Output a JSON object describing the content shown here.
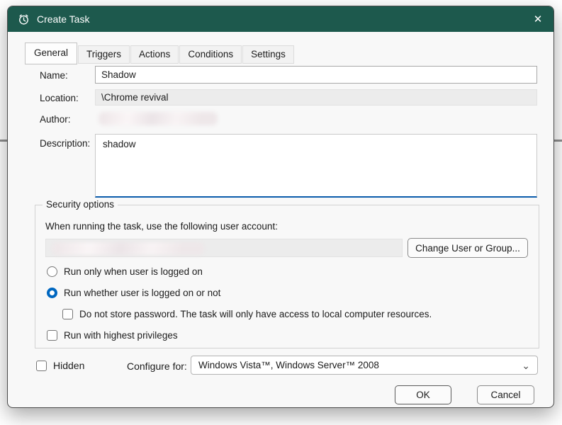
{
  "window": {
    "title": "Create Task"
  },
  "icons": {
    "close": "✕",
    "chevron_down": "⌄",
    "app": "clock-icon"
  },
  "colors": {
    "titlebar": "#1d594d",
    "accent_blue": "#0067c0",
    "focus_underline": "#0b5cab"
  },
  "tabs": [
    {
      "label": "General",
      "active": true
    },
    {
      "label": "Triggers",
      "active": false
    },
    {
      "label": "Actions",
      "active": false
    },
    {
      "label": "Conditions",
      "active": false
    },
    {
      "label": "Settings",
      "active": false
    }
  ],
  "general": {
    "name_label": "Name:",
    "name_value": "Shadow",
    "location_label": "Location:",
    "location_value": "\\Chrome revival",
    "author_label": "Author:",
    "description_label": "Description:",
    "description_value": "shadow"
  },
  "security": {
    "group_title": "Security options",
    "account_caption": "When running the task, use the following user account:",
    "change_user_button": "Change User or Group...",
    "radio_logged_on": "Run only when user is logged on",
    "radio_whether": "Run whether user is logged on or not",
    "checkbox_no_password": "Do not store password.  The task will only have access to local computer resources.",
    "checkbox_highest": "Run with highest privileges"
  },
  "footer": {
    "hidden_label": "Hidden",
    "configure_label": "Configure for:",
    "configure_value": "Windows Vista™, Windows Server™ 2008",
    "ok": "OK",
    "cancel": "Cancel"
  }
}
